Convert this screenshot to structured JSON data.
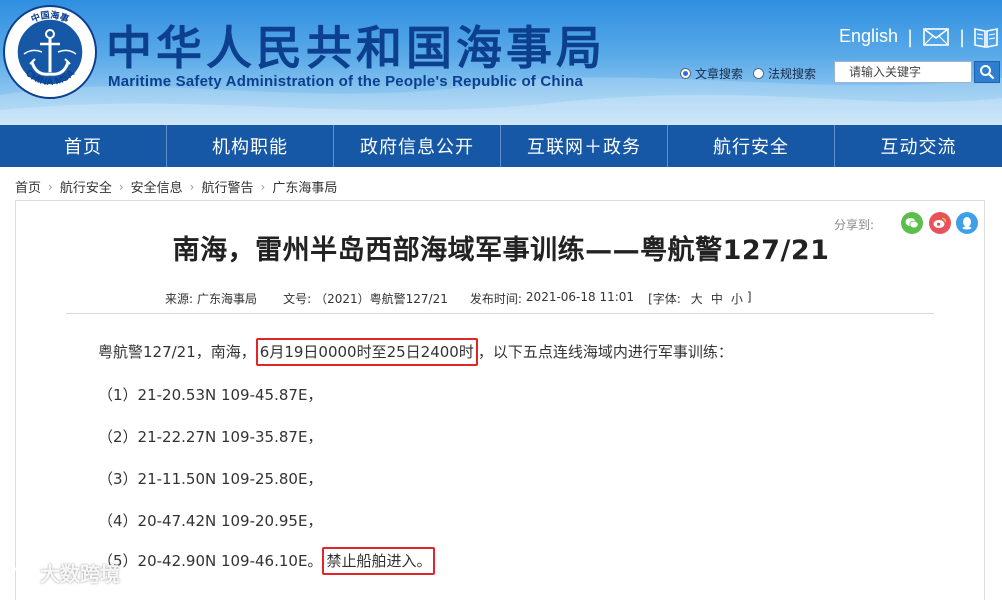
{
  "header": {
    "title_cn": "中华人民共和国海事局",
    "title_en": "Maritime Safety Administration of the People's Republic of China",
    "logo_text": "CHINA MSA",
    "logo_text_cn": "中国海事",
    "language_link": "English",
    "separator": "|",
    "mail_icon": "mail-icon",
    "book_icon": "book-icon",
    "search": {
      "option_article": "文章搜索",
      "option_law": "法规搜索",
      "selected": "文章搜索",
      "placeholder": "请输入关键字"
    }
  },
  "nav": {
    "items": [
      "首页",
      "机构职能",
      "政府信息公开",
      "互联网＋政务",
      "航行安全",
      "互动交流"
    ]
  },
  "breadcrumb": [
    "首页",
    "航行安全",
    "安全信息",
    "航行警告",
    "广东海事局"
  ],
  "article": {
    "share_label": "分享到:",
    "share_icons": [
      "wechat-icon",
      "weibo-icon",
      "qq-icon"
    ],
    "title": "南海，雷州半岛西部海域军事训练——粤航警127/21",
    "meta": {
      "source_label": "来源:",
      "source": "广东海事局",
      "doc_label": "文号:",
      "doc_no": "（2021）粤航警127/21",
      "time_label": "发布时间:",
      "time": "2021-06-18 11:01",
      "font_label_open": "[字体:",
      "font_large": "大",
      "font_medium": "中",
      "font_small": "小",
      "font_label_close": "]"
    },
    "intro_prefix": "粤航警127/21，南海，",
    "intro_highlight": "6月19日0000时至25日2400时",
    "intro_suffix": "，以下五点连线海域内进行军事训练：",
    "points": [
      "（1）21-20.53N 109-45.87E，",
      "（2）21-22.27N 109-35.87E，",
      "（3）21-11.50N 109-25.80E，",
      "（4）20-47.42N 109-20.95E，",
      "（5）20-42.90N 109-46.10E。"
    ],
    "closing_highlight": "禁止船舶进入。"
  },
  "watermark": "大数跨境",
  "colors": {
    "nav_bg": "#1658a6",
    "title_blue": "#0d3f8f",
    "highlight_red": "#e0262b"
  }
}
